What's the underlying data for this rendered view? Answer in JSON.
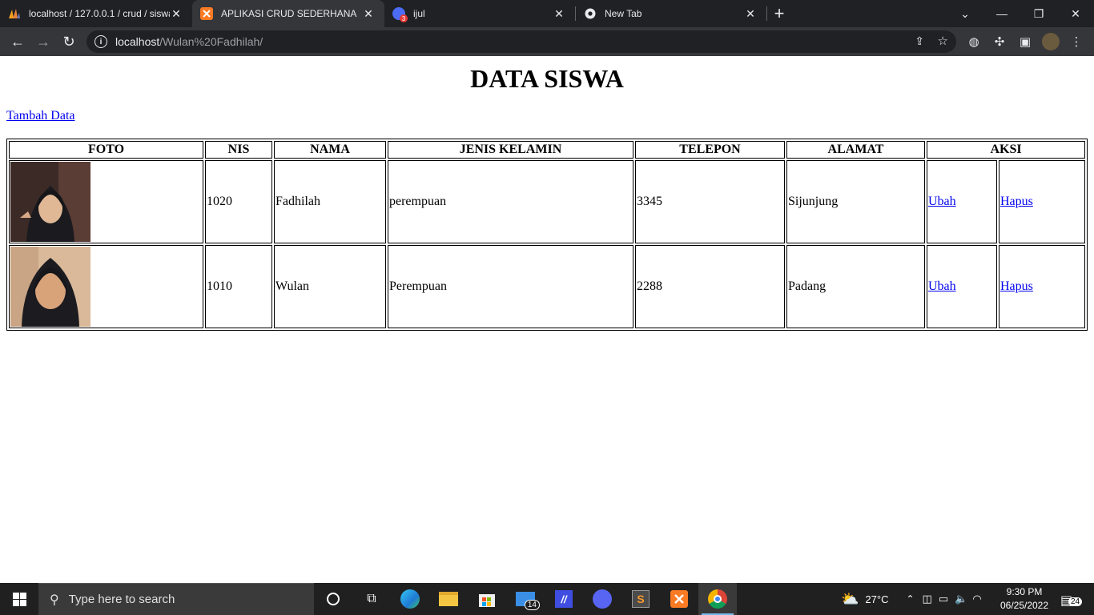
{
  "browser": {
    "tabs": [
      {
        "title": "localhost / 127.0.0.1 / crud / siswa",
        "active": false
      },
      {
        "title": "APLIKASI CRUD SEDERHANA",
        "active": true
      },
      {
        "title": "ijul",
        "active": false,
        "badge": "3"
      },
      {
        "title": "New Tab",
        "active": false
      }
    ],
    "url_host": "localhost",
    "url_path": "/Wulan%20Fadhilah/"
  },
  "page": {
    "heading": "DATA SISWA",
    "add_link": "Tambah Data",
    "table": {
      "headers": [
        "FOTO",
        "NIS",
        "NAMA",
        "JENIS KELAMIN",
        "TELEPON",
        "ALAMAT",
        "AKSI"
      ],
      "rows": [
        {
          "nis": "1020",
          "nama": "Fadhilah",
          "jenis_kelamin": "perempuan",
          "telepon": "3345",
          "alamat": "Sijunjung",
          "edit": "Ubah",
          "delete": "Hapus"
        },
        {
          "nis": "1010",
          "nama": "Wulan",
          "jenis_kelamin": "Perempuan",
          "telepon": "2288",
          "alamat": "Padang",
          "edit": "Ubah",
          "delete": "Hapus"
        }
      ]
    }
  },
  "taskbar": {
    "search_placeholder": "Type here to search",
    "mail_badge": "14",
    "weather": "27°C",
    "time": "9:30 PM",
    "date": "06/25/2022",
    "notification_count": "24"
  }
}
